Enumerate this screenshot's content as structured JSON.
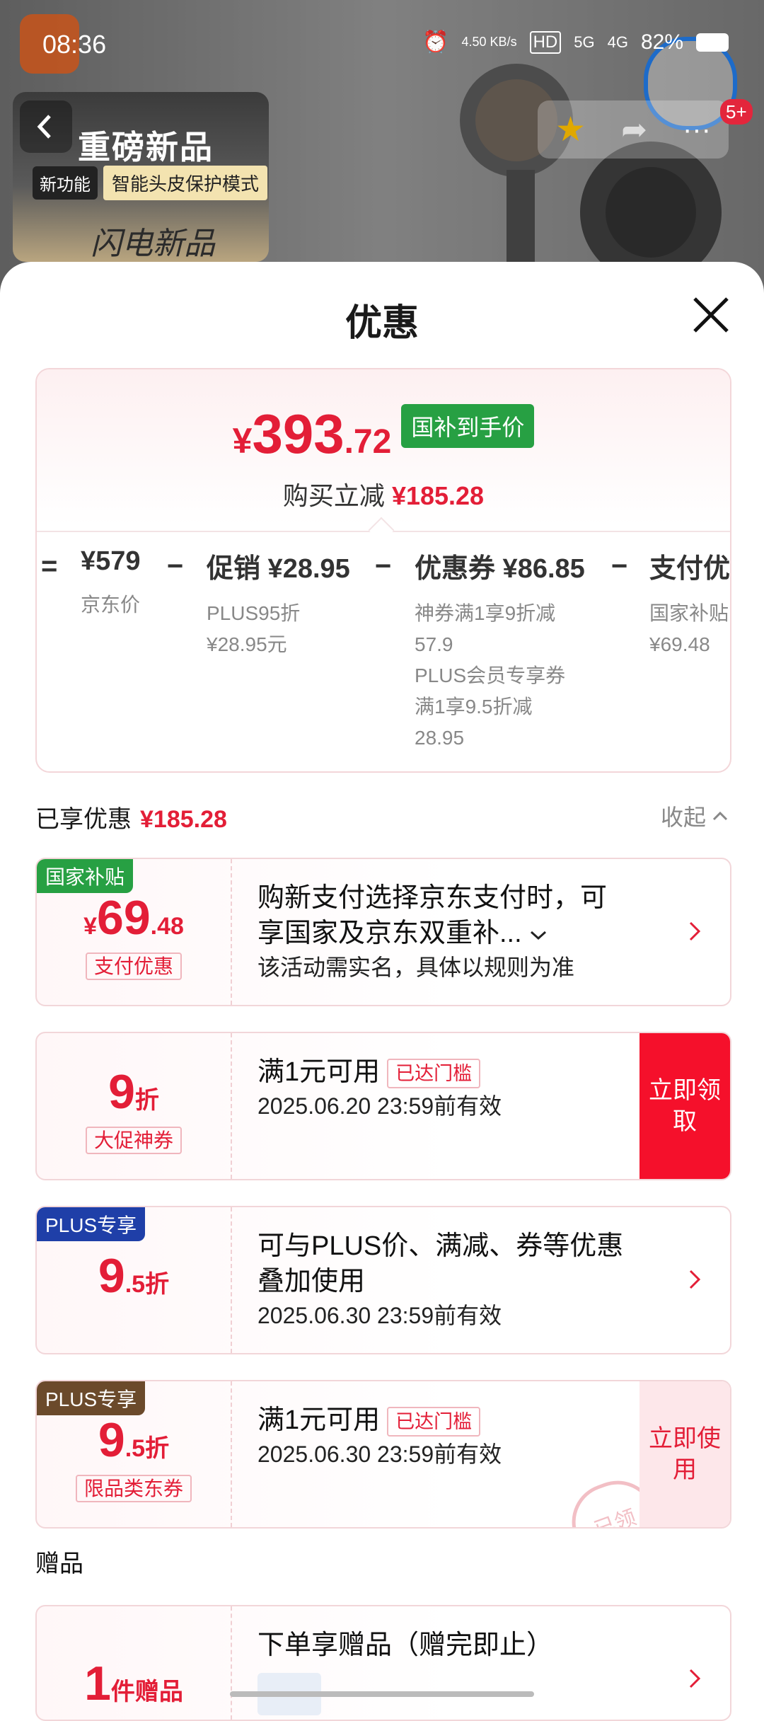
{
  "status_bar": {
    "time": "08:36",
    "net_speed": "4.50 KB/s",
    "hd": "HD",
    "net1": "5G",
    "net2": "4G",
    "battery": "82%"
  },
  "promo": {
    "headline": "重磅新品",
    "feature_pill": "新功能",
    "feature_text": "智能头皮保护模式",
    "script_text": "闪电新品"
  },
  "header_badge": "5+",
  "sheet": {
    "title": "优惠"
  },
  "summary": {
    "currency": "¥",
    "price_int": "393",
    "price_dec": ".72",
    "price_tag": "国补到手价",
    "save_label": "购买立减",
    "save_amount": "¥185.28",
    "calc": [
      {
        "op": "=",
        "value": "¥579",
        "subs": [
          "京东价"
        ]
      },
      {
        "op": "−",
        "value": "促销 ¥28.95",
        "subs": [
          "PLUS95折",
          "¥28.95元"
        ]
      },
      {
        "op": "−",
        "value": "优惠券 ¥86.85",
        "subs": [
          "神券满1享9折减",
          "57.9",
          "PLUS会员专享券",
          "满1享9.5折减",
          "28.95"
        ]
      },
      {
        "op": "−",
        "value": "支付优惠",
        "subs": [
          "国家补贴",
          "¥69.48"
        ]
      }
    ]
  },
  "applied": {
    "label": "已享优惠",
    "amount": "¥185.28",
    "collapse": "收起"
  },
  "cards": [
    {
      "corner": "国家补贴",
      "currency": "¥",
      "big": "69",
      "small": ".48",
      "box": "支付优惠",
      "line1": "购新支付选择京东支付时，可",
      "line1b": "享国家及京东双重补...",
      "line2": "该活动需实名，具体以规则为准"
    },
    {
      "big": "9",
      "small": "折",
      "box": "大促神券",
      "line1": "满1元可用",
      "chip": "已达门槛",
      "line2": "2025.06.20 23:59前有效",
      "action": "立即领取"
    },
    {
      "corner": "PLUS专享",
      "big": "9",
      "small": ".5折",
      "line1": "可与PLUS价、满减、券等优惠",
      "line1b": "叠加使用",
      "line2": "2025.06.30 23:59前有效"
    },
    {
      "corner": "PLUS专享",
      "big": "9",
      "small": ".5折",
      "box": "限品类东券",
      "line1": "满1元可用",
      "chip": "已达门槛",
      "line2": "2025.06.30 23:59前有效",
      "action": "立即使用",
      "stamp": "已领"
    }
  ],
  "gift": {
    "section": "赠品",
    "big": "1",
    "small": "件赠品",
    "line1": "下单享赠品（赠完即止）"
  },
  "colors": {
    "accent": "#e31e37",
    "green": "#27a043",
    "plus_blue": "#1f3fa8",
    "plus_brown": "#6b4a2b"
  }
}
